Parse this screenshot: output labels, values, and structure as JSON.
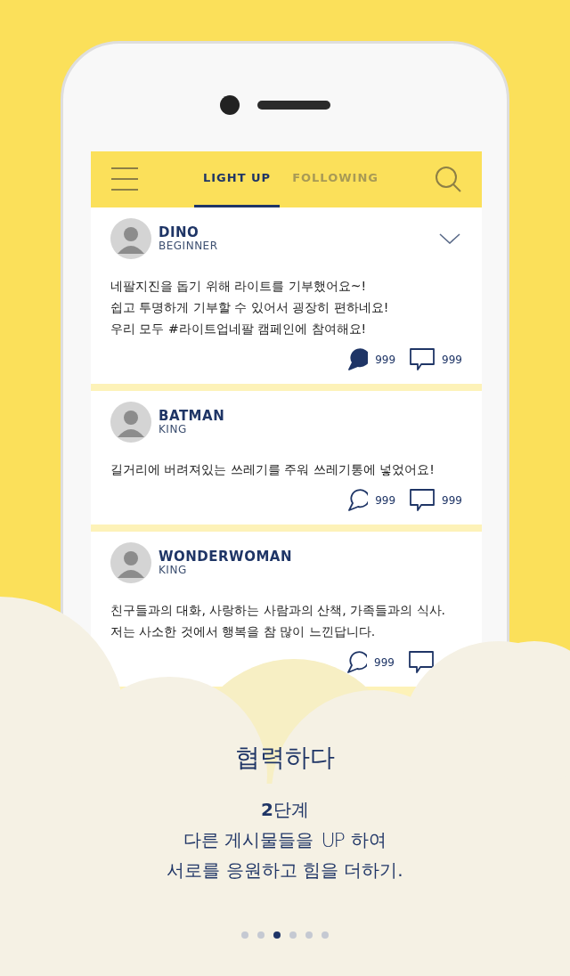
{
  "header": {
    "tabs": [
      {
        "label": "LIGHT UP",
        "selected": true
      },
      {
        "label": "FOLLOWING",
        "selected": false
      }
    ]
  },
  "posts": [
    {
      "name": "DINO",
      "level": "BEGINNER",
      "has_menu": true,
      "text": "네팔지진을 돕기 위해 라이트를 기부했어요~!\n쉽고 투명하게 기부할 수 있어서 굉장히 편하네요!\n우리 모두 #라이트업네팔 캠페인에 참여해요!",
      "liked": true,
      "likes": "999",
      "comments": "999"
    },
    {
      "name": "BATMAN",
      "level": "KING",
      "has_menu": false,
      "text": "길거리에 버려져있는 쓰레기를 주워 쓰레기통에 넣었어요!",
      "liked": false,
      "likes": "999",
      "comments": "999"
    },
    {
      "name": "WONDERWOMAN",
      "level": "KING",
      "has_menu": false,
      "text": "친구들과의 대화, 사랑하는 사람과의 산책, 가족들과의 식사.\n저는 사소한 것에서 행복을 참 많이 느낀답니다.",
      "liked": false,
      "likes": "999"
    }
  ],
  "onboarding": {
    "title": "협력하다",
    "step": "**2**단계",
    "line_1": {
      "before": "다른 게시물들을",
      "logo": "UP",
      "after": "하여"
    },
    "line_2": "서로를 응원하고 힘을 더하기."
  },
  "pages": [
    {
      "selected": false
    },
    {
      "selected": false
    },
    {
      "selected": true
    },
    {
      "selected": false
    },
    {
      "selected": false
    },
    {
      "selected": false
    }
  ]
}
